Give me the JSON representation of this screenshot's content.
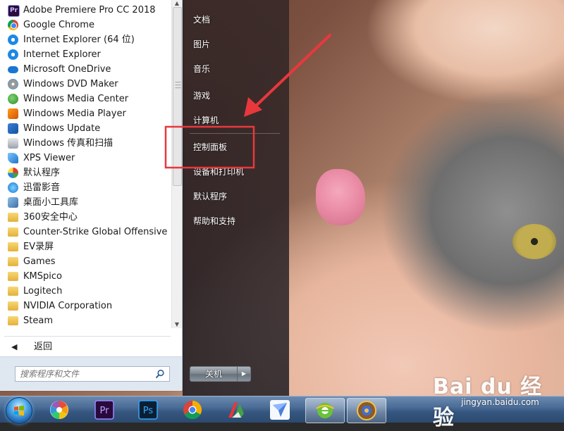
{
  "programs": [
    {
      "label": "Adobe Premiere Pro CC 2018",
      "icon": "premiere-icon"
    },
    {
      "label": "Google Chrome",
      "icon": "chrome-icon"
    },
    {
      "label": "Internet Explorer (64 位)",
      "icon": "ie-icon"
    },
    {
      "label": "Internet Explorer",
      "icon": "ie-icon"
    },
    {
      "label": "Microsoft OneDrive",
      "icon": "onedrive-icon"
    },
    {
      "label": "Windows DVD Maker",
      "icon": "dvd-maker-icon"
    },
    {
      "label": "Windows Media Center",
      "icon": "media-center-icon"
    },
    {
      "label": "Windows Media Player",
      "icon": "media-player-icon"
    },
    {
      "label": "Windows Update",
      "icon": "windows-update-icon"
    },
    {
      "label": "Windows 传真和扫描",
      "icon": "fax-scan-icon"
    },
    {
      "label": "XPS Viewer",
      "icon": "xps-viewer-icon"
    },
    {
      "label": "默认程序",
      "icon": "default-programs-icon"
    },
    {
      "label": "迅雷影音",
      "icon": "xunlei-icon"
    },
    {
      "label": "桌面小工具库",
      "icon": "gadgets-icon"
    },
    {
      "label": "360安全中心",
      "icon": "folder-icon"
    },
    {
      "label": "Counter-Strike Global Offensive",
      "icon": "folder-icon"
    },
    {
      "label": "EV录屏",
      "icon": "folder-icon"
    },
    {
      "label": "Games",
      "icon": "folder-icon"
    },
    {
      "label": "KMSpico",
      "icon": "folder-icon"
    },
    {
      "label": "Logitech",
      "icon": "folder-icon"
    },
    {
      "label": "NVIDIA Corporation",
      "icon": "folder-icon"
    },
    {
      "label": "Steam",
      "icon": "folder-icon"
    }
  ],
  "back": {
    "label": "返回"
  },
  "search": {
    "placeholder": "搜索程序和文件"
  },
  "places": {
    "documents": "文档",
    "pictures": "图片",
    "music": "音乐",
    "games": "游戏",
    "computer": "计算机",
    "control_panel": "控制面板",
    "devices_printers": "设备和打印机",
    "default_programs": "默认程序",
    "help_support": "帮助和支持"
  },
  "shutdown": {
    "label": "关机"
  },
  "taskbar": {
    "items": [
      "start-orb",
      "picasa-icon",
      "premiere-icon",
      "photoshop-icon",
      "chrome-icon",
      "wps-icon",
      "feishu-icon",
      "ie-green-icon",
      "hearthstone-icon"
    ]
  },
  "watermark": {
    "brand": "Bai du 经验",
    "sub": "jingyan.baidu.com"
  },
  "colors": {
    "annotation": "#e8383d"
  }
}
